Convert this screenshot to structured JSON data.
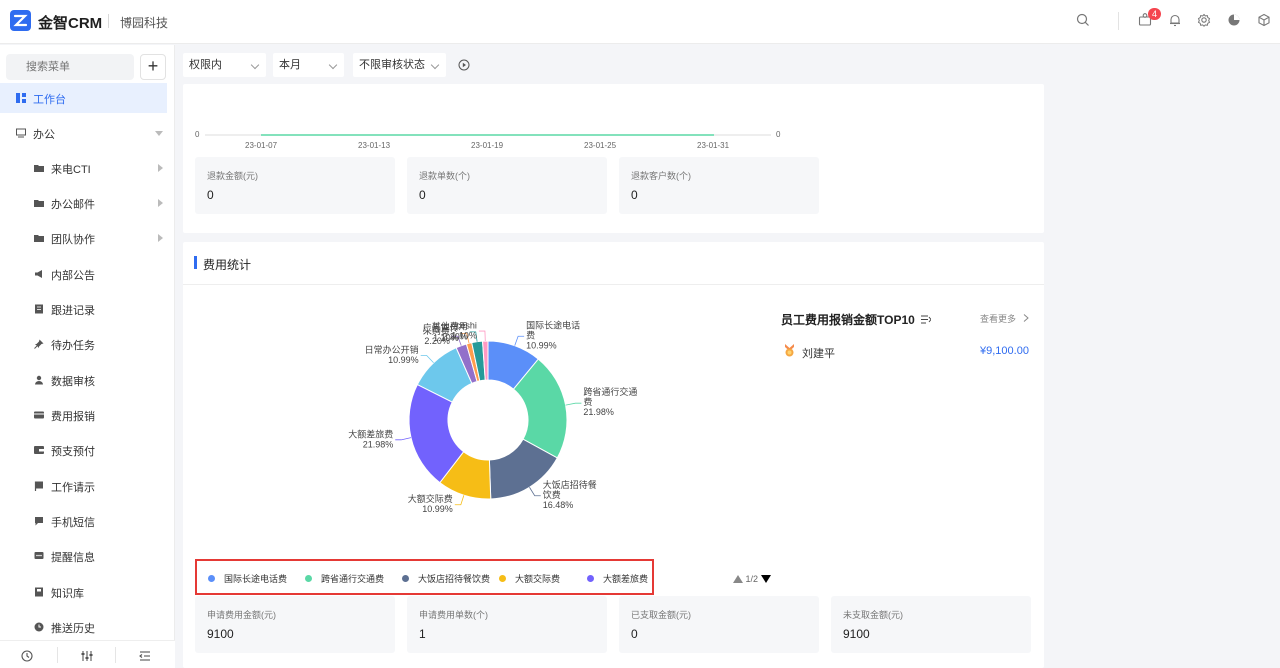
{
  "header": {
    "brand": "金智CRM",
    "company": "博园科技",
    "notification_count": "4",
    "icons": [
      "search-icon",
      "message-icon",
      "bell-icon",
      "settings-icon",
      "pie-chart-icon",
      "cube-icon"
    ]
  },
  "sidebar": {
    "search_placeholder": "搜索菜单",
    "add_label": "+",
    "items": [
      {
        "label": "工作台",
        "icon": "dashboard-icon",
        "active": true
      },
      {
        "label": "办公",
        "icon": "office-icon",
        "expanded": true
      },
      {
        "label": "来电CTI",
        "icon": "folder-icon",
        "has_children": true
      },
      {
        "label": "办公邮件",
        "icon": "folder-icon",
        "has_children": true
      },
      {
        "label": "团队协作",
        "icon": "folder-icon",
        "has_children": true
      },
      {
        "label": "内部公告",
        "icon": "announcement-icon"
      },
      {
        "label": "跟进记录",
        "icon": "record-icon"
      },
      {
        "label": "待办任务",
        "icon": "pin-icon"
      },
      {
        "label": "数据审核",
        "icon": "user-icon"
      },
      {
        "label": "费用报销",
        "icon": "card-icon"
      },
      {
        "label": "预支预付",
        "icon": "wallet-icon"
      },
      {
        "label": "工作请示",
        "icon": "flag-icon"
      },
      {
        "label": "手机短信",
        "icon": "sms-icon"
      },
      {
        "label": "提醒信息",
        "icon": "reminder-icon"
      },
      {
        "label": "知识库",
        "icon": "book-icon"
      },
      {
        "label": "推送历史",
        "icon": "clock-icon"
      }
    ],
    "footer_icons": [
      "history-icon",
      "sliders-icon",
      "collapse-icon"
    ]
  },
  "filters": {
    "scope": "权限内",
    "period": "本月",
    "audit": "不限审核状态"
  },
  "refund": {
    "axis_dates": [
      "23-01-07",
      "23-01-13",
      "23-01-19",
      "23-01-25",
      "23-01-31"
    ],
    "axis_left_value": "0",
    "axis_right_value": "0",
    "stats": [
      {
        "label": "退款金额(元)",
        "value": "0"
      },
      {
        "label": "退款单数(个)",
        "value": "0"
      },
      {
        "label": "退款客户数(个)",
        "value": "0"
      }
    ]
  },
  "expense": {
    "title": "费用统计",
    "chart_data": {
      "type": "pie",
      "donut": true,
      "slices": [
        {
          "name": "国际长途电话费",
          "label": "国际长途电话\n费",
          "percent": 10.99,
          "color": "#5b8ff9"
        },
        {
          "name": "跨省通行交通费",
          "label": "跨省通行交通\n费",
          "percent": 21.98,
          "color": "#5ad8a6"
        },
        {
          "name": "大饭店招待餐饮费",
          "label": "大饭店招待餐\n饮费",
          "percent": 16.48,
          "color": "#5d7092"
        },
        {
          "name": "大额交际费",
          "label": "大额交际费",
          "percent": 10.99,
          "color": "#f6bd16"
        },
        {
          "name": "大额差旅费",
          "label": "大额差旅费",
          "percent": 21.98,
          "color": "#7262fd"
        },
        {
          "name": "日常办公开销",
          "label": "日常办公开销",
          "percent": 10.99,
          "color": "#6dc8ec"
        },
        {
          "name": "采购费",
          "label": "采购费",
          "percent": 2.2,
          "color": "#9270ca"
        },
        {
          "name": "广告宣传",
          "label": "广告宣传",
          "percent": 1.1,
          "color": "#ff9d4d"
        },
        {
          "name": "其他费用",
          "label": "其他费用",
          "percent": 2.2,
          "color": "#269a99"
        },
        {
          "name": "ceshi",
          "label": "ceshi",
          "percent": 1.1,
          "color": "#ff99c3"
        }
      ]
    },
    "legend": [
      {
        "label": "国际长途电话费",
        "color": "#5b8ff9"
      },
      {
        "label": "跨省通行交通费",
        "color": "#5ad8a6"
      },
      {
        "label": "大饭店招待餐饮费",
        "color": "#5d7092"
      },
      {
        "label": "大额交际费",
        "color": "#f6bd16"
      },
      {
        "label": "大额差旅费",
        "color": "#7262fd"
      }
    ],
    "legend_page": "1/2",
    "top10": {
      "title": "员工费用报销金额TOP10",
      "more": "查看更多",
      "entries": [
        {
          "name": "刘建平",
          "amount": "¥9,100.00"
        }
      ]
    },
    "stats": [
      {
        "label": "申请费用金额(元)",
        "value": "9100"
      },
      {
        "label": "申请费用单数(个)",
        "value": "1"
      },
      {
        "label": "已支取金额(元)",
        "value": "0"
      },
      {
        "label": "未支取金额(元)",
        "value": "9100"
      }
    ]
  }
}
